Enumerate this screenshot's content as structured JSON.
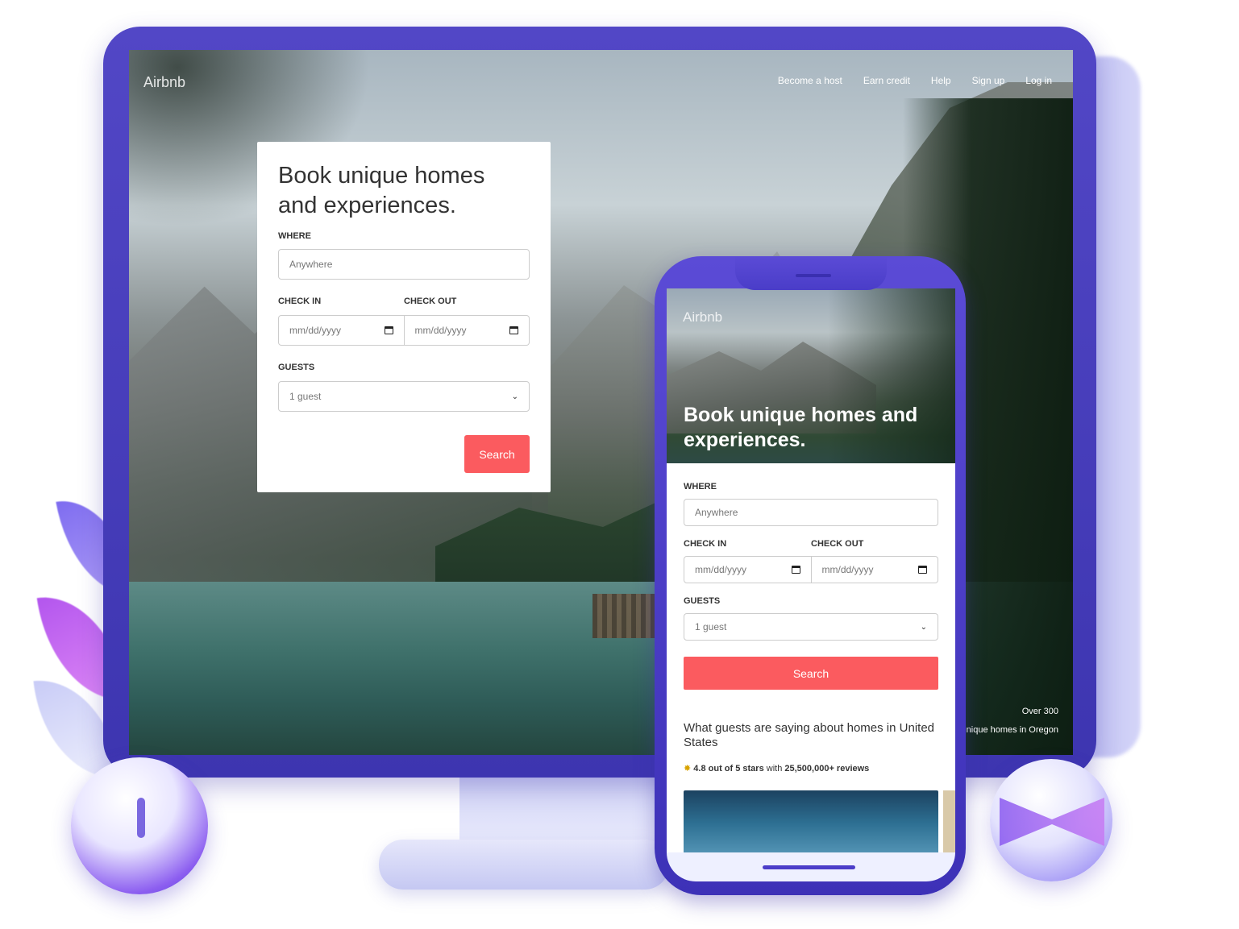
{
  "desktop": {
    "brand": "Airbnb",
    "nav": [
      "Become a host",
      "Earn credit",
      "Help",
      "Sign up",
      "Log in"
    ],
    "card": {
      "title": "Book unique homes and experiences.",
      "where_label": "WHERE",
      "where_placeholder": "Anywhere",
      "checkin_label": "CHECK IN",
      "checkout_label": "CHECK OUT",
      "checkin_placeholder": "mm/dd/yyyy",
      "checkout_placeholder": "mm/dd/yyyy",
      "guests_label": "GUESTS",
      "guests_value": "1 guest",
      "search_button": "Search"
    },
    "stats": {
      "line1": "Over 300",
      "line2": "unique homes in Oregon"
    }
  },
  "mobile": {
    "brand": "Airbnb",
    "hero_title": "Book unique homes and experiences.",
    "where_label": "WHERE",
    "where_placeholder": "Anywhere",
    "checkin_label": "CHECK IN",
    "checkout_label": "CHECK OUT",
    "checkin_placeholder": "mm/dd/yyyy",
    "checkout_placeholder": "mm/dd/yyyy",
    "guests_label": "GUESTS",
    "guests_value": "1 guest",
    "search_button": "Search",
    "reviews_heading": "What guests are saying about homes in United States",
    "rating_icon": "✸",
    "rating_bold": "4.8 out of 5 stars",
    "rating_with": "with",
    "rating_count": "25,500,000+ reviews"
  },
  "colors": {
    "accent": "#fb5b5f",
    "device_frame": "#4a3fc0"
  }
}
